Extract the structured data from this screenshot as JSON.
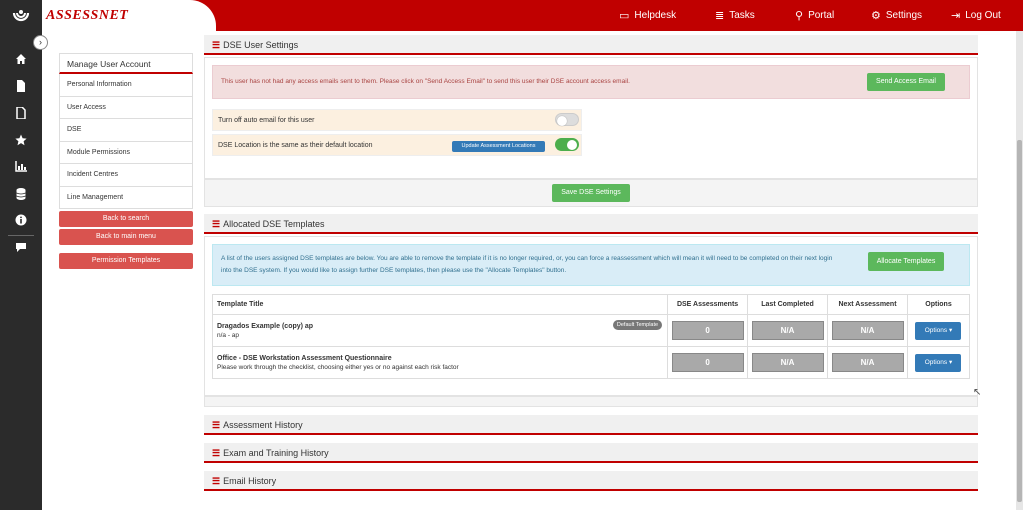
{
  "brand": {
    "logo_assess": "ASSESS",
    "logo_net": "NET"
  },
  "topnav": [
    {
      "icon": "▭",
      "label": "Helpdesk"
    },
    {
      "icon": "≣",
      "label": "Tasks"
    },
    {
      "icon": "⚲",
      "label": "Portal"
    },
    {
      "icon": "⚙",
      "label": "Settings"
    },
    {
      "icon": "⇥",
      "label": "Log Out"
    }
  ],
  "sidebar": {
    "collapse_icon": "›"
  },
  "leftmenu": {
    "title": "Manage User Account",
    "items": [
      "Personal Information",
      "User Access",
      "DSE",
      "Module Permissions",
      "Incident Centres",
      "Line Management"
    ],
    "back_search": "Back to search",
    "back_main": "Back to main menu",
    "permission_templates": "Permission Templates"
  },
  "dse_settings": {
    "header": "DSE User Settings",
    "alert": "This user has not had any access emails sent to them. Please click on \"Send Access Email\" to send this user their DSE account access email.",
    "send_email_btn": "Send Access Email",
    "toggle1_label": "Turn off auto email for this user",
    "toggle1_on": false,
    "toggle2_label": "DSE Location is the same as their default location",
    "toggle2_on": true,
    "update_locations_btn": "Update Assessment Locations",
    "save_btn": "Save DSE Settings"
  },
  "templates": {
    "header": "Allocated DSE Templates",
    "info": "A list of the users assigned DSE templates are below. You are able to remove the template if it is no longer required, or, you can force a reassessment which will mean it will need to be completed on their next login into the DSE system. If you would like to assign further DSE templates, then please use the \"Allocate Templates\" button.",
    "allocate_btn": "Allocate Templates",
    "columns": [
      "Template Title",
      "DSE Assessments",
      "Last Completed",
      "Next Assessment",
      "Options"
    ],
    "rows": [
      {
        "title": "Dragados Example (copy) ap",
        "sub": "n/a - ap",
        "badge": "Default Template",
        "assessments": "0",
        "last": "N/A",
        "next": "N/A",
        "options": "Options ▾"
      },
      {
        "title": "Office - DSE Workstation Assessment Questionnaire",
        "sub": "Please work through the checklist, choosing either yes or no against each risk factor",
        "badge": "",
        "assessments": "0",
        "last": "N/A",
        "next": "N/A",
        "options": "Options ▾"
      }
    ]
  },
  "sections": {
    "assessment_history": "Assessment History",
    "exam_training": "Exam and Training History",
    "email_history": "Email History"
  },
  "colors": {
    "brand_red": "#c00000",
    "green": "#5cb85c",
    "blue": "#337ab7",
    "sidebar": "#2b2b2b"
  }
}
